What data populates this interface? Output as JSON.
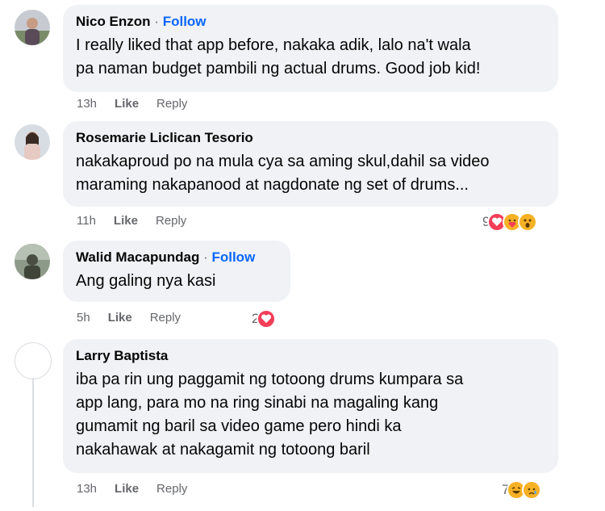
{
  "comments": [
    {
      "author": "Nico Enzon",
      "follow": "Follow",
      "text_lines": [
        "I really liked that app before, nakaka adik, lalo na't wala",
        "pa naman budget pambili ng actual drums. Good job kid!"
      ],
      "time": "13h",
      "like": "Like",
      "reply": "Reply"
    },
    {
      "author": "Rosemarie Liclican Tesorio",
      "text_lines": [
        "nakakaproud po na mula cya sa aming skul,dahil sa video",
        "maraming nakapanood at nagdonate ng set of drums..."
      ],
      "time": "11h",
      "like": "Like",
      "reply": "Reply",
      "reaction_count": "9",
      "reaction_icons": [
        "love-icon",
        "care-icon",
        "wow-icon"
      ]
    },
    {
      "author": "Walid Macapundag",
      "follow": "Follow",
      "text_lines": [
        "Ang galing nya kasi"
      ],
      "time": "5h",
      "like": "Like",
      "reply": "Reply",
      "reaction_count": "2",
      "reaction_icons": [
        "love-icon"
      ]
    },
    {
      "author": "Larry Baptista",
      "text_lines": [
        "iba pa rin ung paggamit ng totoong drums kumpara sa",
        "app lang, para mo na ring sinabi na magaling kang",
        "gumamit ng baril sa video game pero hindi ka",
        "nakahawak at nakagamit ng totoong baril"
      ],
      "time": "13h",
      "like": "Like",
      "reply": "Reply",
      "reaction_count": "7",
      "reaction_icons": [
        "haha-icon",
        "sad-icon"
      ]
    }
  ],
  "separator": "·",
  "colors": {
    "bubble": "#f0f2f5",
    "follow": "#0866ff",
    "meta": "#65676b",
    "love": "#f33e58",
    "haha": "#f7b125"
  }
}
